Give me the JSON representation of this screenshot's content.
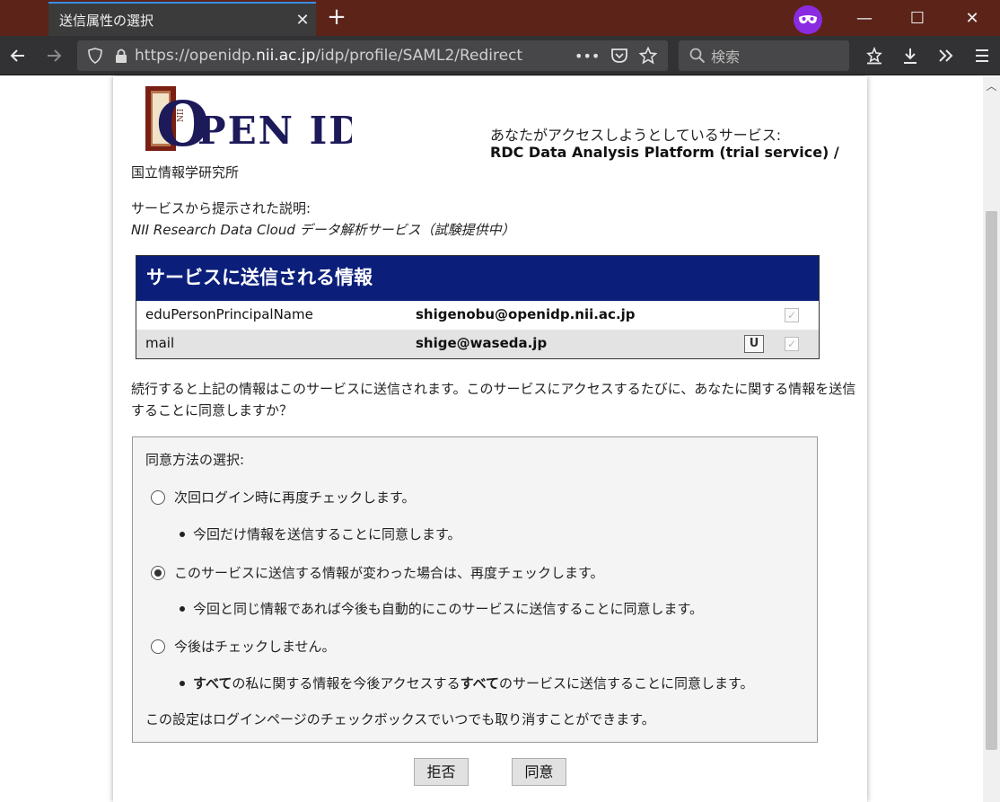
{
  "browser": {
    "tab_title": "送信属性の選択",
    "tab_close": "✕",
    "new_tab": "+",
    "url_prefix": "https://openidp.",
    "url_host": "nii.ac.jp",
    "url_suffix": "/idp/profile/SAML2/Redirect",
    "url_more": "•••",
    "search_placeholder": "検索",
    "window_minimize": "—",
    "window_maximize": "☐",
    "window_close": "✕"
  },
  "logo": {
    "text": "OPEN IDP"
  },
  "org_name": "国立情報学研究所",
  "service": {
    "label": "あなたがアクセスしようとしているサービス:",
    "name": "RDC Data Analysis Platform (trial service) /"
  },
  "description": {
    "label": "サービスから提示された説明:",
    "text": "NII Research Data Cloud データ解析サービス（試験提供中）"
  },
  "info_table": {
    "title": "サービスに送信される情報",
    "rows": [
      {
        "name": "eduPersonPrincipalName",
        "value": "shigenobu@openidp.nii.ac.jp",
        "badge": ""
      },
      {
        "name": "mail",
        "value": "shige@waseda.jp",
        "badge": "U"
      }
    ]
  },
  "notice": "続行すると上記の情報はこのサービスに送信されます。このサービスにアクセスするたびに、あなたに関する情報を送信することに同意しますか？",
  "consent": {
    "title": "同意方法の選択:",
    "options": [
      {
        "label": "次回ログイン時に再度チェックします。",
        "detail_pre": "",
        "detail_bold": "",
        "detail_mid": "",
        "detail_bold2": "",
        "detail_post": "今回だけ情報を送信することに同意します。",
        "selected": false
      },
      {
        "label": "このサービスに送信する情報が変わった場合は、再度チェックします。",
        "detail_pre": "",
        "detail_bold": "",
        "detail_mid": "",
        "detail_bold2": "",
        "detail_post": "今回と同じ情報であれば今後も自動的にこのサービスに送信することに同意します。",
        "selected": true
      },
      {
        "label": "今後はチェックしません。",
        "detail_pre": "",
        "detail_bold": "すべて",
        "detail_mid": "の私に関する情報を今後アクセスする",
        "detail_bold2": "すべて",
        "detail_post": "のサービスに送信することに同意します。",
        "selected": false
      }
    ],
    "note": "この設定はログインページのチェックボックスでいつでも取り消すことができます。"
  },
  "buttons": {
    "reject": "拒否",
    "accept": "同意"
  },
  "colors": {
    "header_blue": "#0b1f7a",
    "titlebar": "#5c2419",
    "toolbar": "#323234",
    "private_purple": "#8a2be2"
  }
}
